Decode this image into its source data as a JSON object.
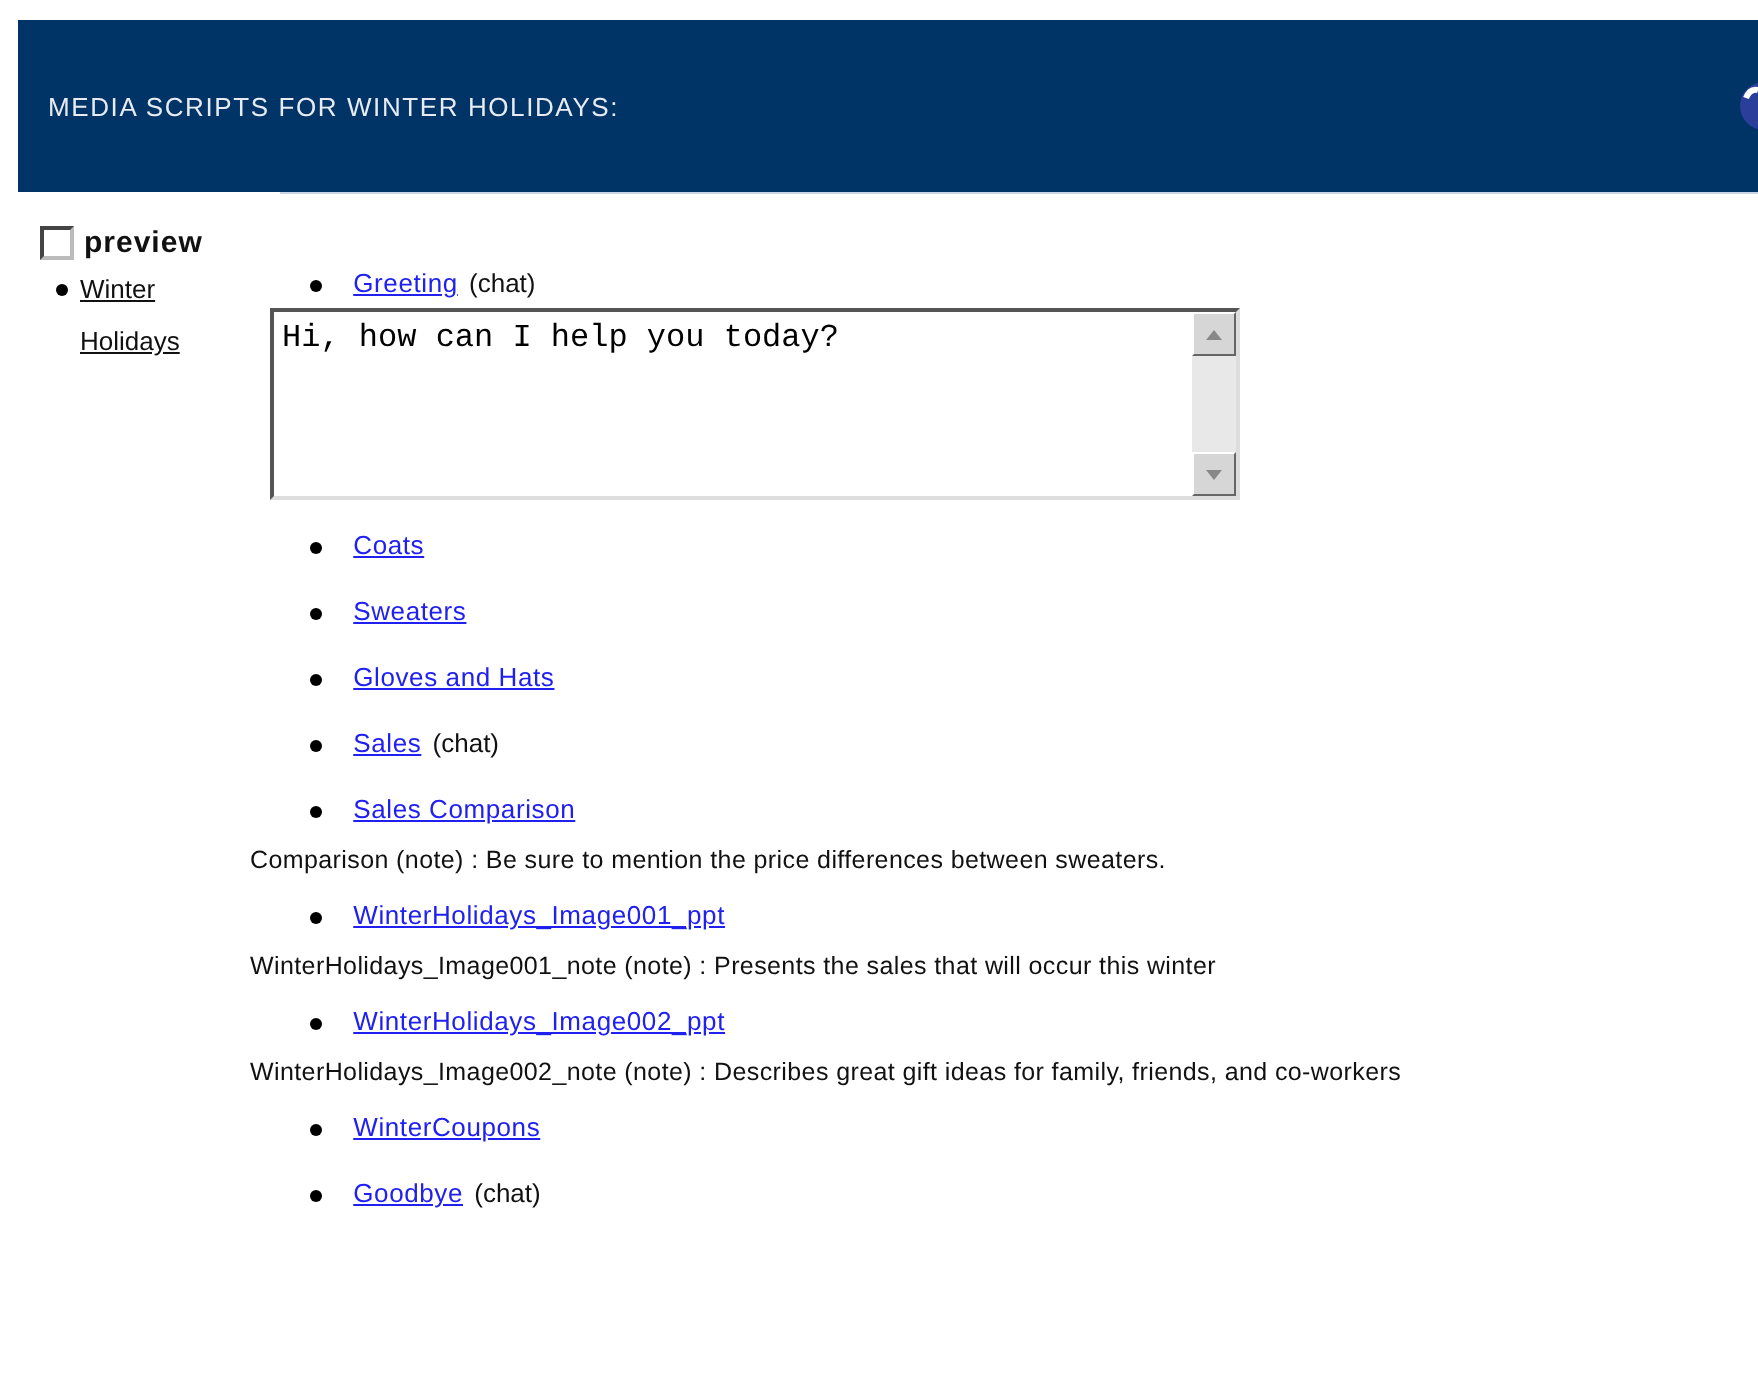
{
  "header": {
    "title": "MEDIA SCRIPTS FOR WINTER HOLIDAYS:"
  },
  "preview": {
    "label": "preview",
    "checked": false
  },
  "folders": [
    {
      "label": "Winter Holidays"
    }
  ],
  "scripts": [
    {
      "label": "Greeting",
      "tag": "(chat)",
      "value": "Hi, how can I help you today?"
    },
    {
      "label": "Coats"
    },
    {
      "label": "Sweaters"
    },
    {
      "label": "Gloves and Hats"
    },
    {
      "label": "Sales",
      "tag": "(chat)"
    },
    {
      "label": "Sales Comparison",
      "note": "Comparison (note) : Be sure to mention the price differences between sweaters."
    },
    {
      "label": "WinterHolidays_Image001_ppt",
      "note": "WinterHolidays_Image001_note (note) : Presents the sales that will occur this winter"
    },
    {
      "label": "WinterHolidays_Image002_ppt",
      "note": "WinterHolidays_Image002_note (note) : Describes great gift ideas for family, friends, and co-workers"
    },
    {
      "label": "WinterCoupons"
    },
    {
      "label": "Goodbye",
      "tag": "(chat)"
    }
  ]
}
